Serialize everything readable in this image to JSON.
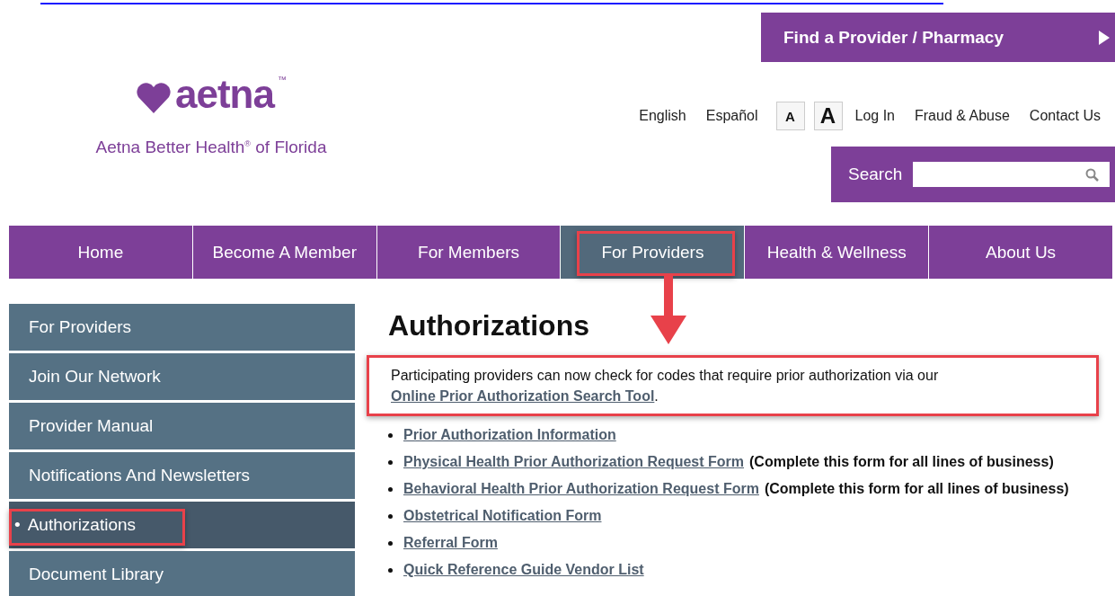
{
  "logo": {
    "wordmark": "aetna",
    "trademark": "™",
    "tagline": "Aetna Better Health$^{®}$ of Florida"
  },
  "find_provider": {
    "label": "Find a Provider / Pharmacy"
  },
  "utility_links": [
    {
      "label": "English",
      "kind": "link"
    },
    {
      "label": "Español",
      "kind": "link"
    },
    {
      "label": "A",
      "kind": "size-small"
    },
    {
      "label": "A",
      "kind": "size-large"
    },
    {
      "label": "Log In",
      "kind": "link"
    },
    {
      "label": "Fraud & Abuse",
      "kind": "link"
    },
    {
      "label": "Contact Us",
      "kind": "link"
    }
  ],
  "search": {
    "label": "Search"
  },
  "nav": [
    {
      "label": "Home",
      "selected": false,
      "annotated": false
    },
    {
      "label": "Become A Member",
      "selected": false,
      "annotated": false
    },
    {
      "label": "For Members",
      "selected": false,
      "annotated": false
    },
    {
      "label": "For Providers",
      "selected": true,
      "annotated": true
    },
    {
      "label": "Health & Wellness",
      "selected": false,
      "annotated": false
    },
    {
      "label": "About Us",
      "selected": false,
      "annotated": false
    }
  ],
  "sidebar": [
    {
      "label": "For Providers",
      "selected": false,
      "annotated": false
    },
    {
      "label": "Join Our Network",
      "selected": false,
      "annotated": false
    },
    {
      "label": "Provider Manual",
      "selected": false,
      "annotated": false
    },
    {
      "label": "Notifications And Newsletters",
      "selected": false,
      "annotated": false
    },
    {
      "label": "Authorizations",
      "selected": true,
      "annotated": true,
      "bullet": "•"
    },
    {
      "label": "Document Library",
      "selected": false,
      "annotated": false
    }
  ],
  "content": {
    "title": "Authorizations",
    "intro": {
      "text": "Participating providers can now check for codes that require prior authorization via our",
      "link": "Online Prior Authorization Search Tool",
      "after": ".",
      "annotated": true
    },
    "links": [
      {
        "label": "Prior Authorization Information"
      },
      {
        "label": "Physical Health Prior Authorization Request Form",
        "note": "(Complete this form for all lines of business)"
      },
      {
        "label": "Behavioral Health Prior Authorization Request Form",
        "note": "(Complete this form for all lines of business)"
      },
      {
        "label": "Obstetrical Notification Form"
      },
      {
        "label": "Referral Form"
      },
      {
        "label": "Quick Reference Guide Vendor List"
      }
    ]
  }
}
